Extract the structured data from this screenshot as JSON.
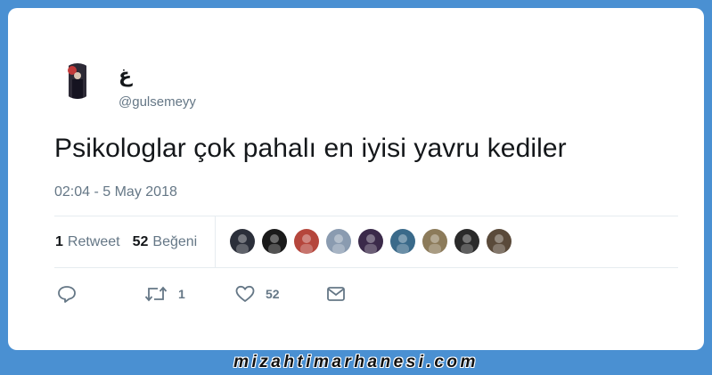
{
  "tweet": {
    "display_name": "غ",
    "handle": "@gulsemeyy",
    "text": "Psikologlar çok pahalı en iyisi yavru kediler",
    "timestamp": "02:04 - 5 May 2018"
  },
  "stats": {
    "retweet_count": "1",
    "retweet_label": "Retweet",
    "like_count": "52",
    "like_label": "Beğeni"
  },
  "likers": [
    {
      "icon": "liker-avatar",
      "color": "#2b2f3a"
    },
    {
      "icon": "liker-avatar",
      "color": "#1a1a1a"
    },
    {
      "icon": "liker-avatar",
      "color": "#b5463c"
    },
    {
      "icon": "liker-avatar",
      "color": "#8a9bb0"
    },
    {
      "icon": "liker-avatar",
      "color": "#3b2a4a"
    },
    {
      "icon": "liker-avatar",
      "color": "#3a6a8a"
    },
    {
      "icon": "liker-avatar",
      "color": "#8c7b5a"
    },
    {
      "icon": "liker-avatar",
      "color": "#2a2a2a"
    },
    {
      "icon": "liker-avatar",
      "color": "#5a4a3a"
    }
  ],
  "actions": {
    "reply_icon": "reply-icon",
    "retweet_icon": "retweet-icon",
    "retweet_count": "1",
    "like_icon": "heart-icon",
    "like_count": "52",
    "dm_icon": "envelope-icon"
  },
  "watermark": "mizahtimarhanesi.com",
  "colors": {
    "background": "#4a90d2",
    "card": "#ffffff",
    "muted_text": "#657786",
    "primary_text": "#14171a"
  }
}
